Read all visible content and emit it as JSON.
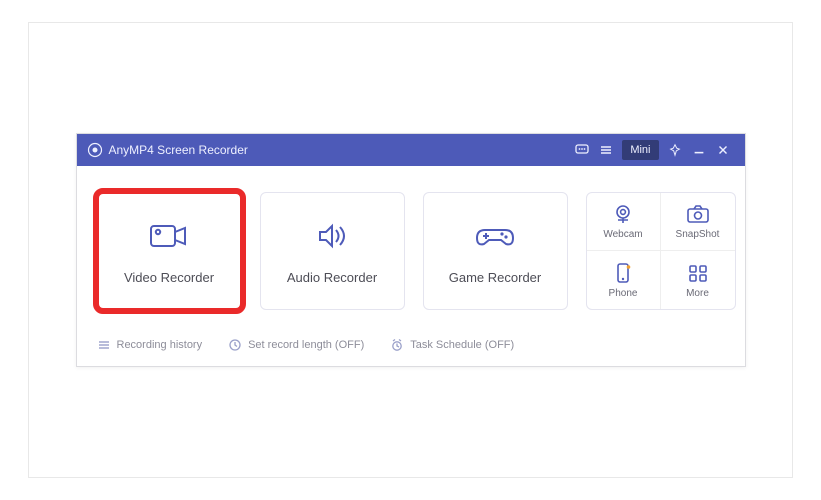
{
  "app": {
    "title": "AnyMP4 Screen Recorder",
    "mini_label": "Mini"
  },
  "modes": {
    "video": {
      "label": "Video Recorder"
    },
    "audio": {
      "label": "Audio Recorder"
    },
    "game": {
      "label": "Game Recorder"
    }
  },
  "side": {
    "webcam": {
      "label": "Webcam"
    },
    "snapshot": {
      "label": "SnapShot"
    },
    "phone": {
      "label": "Phone"
    },
    "more": {
      "label": "More"
    }
  },
  "footer": {
    "history": {
      "label": "Recording history"
    },
    "length": {
      "label": "Set record length (OFF)"
    },
    "schedule": {
      "label": "Task Schedule (OFF)"
    }
  }
}
